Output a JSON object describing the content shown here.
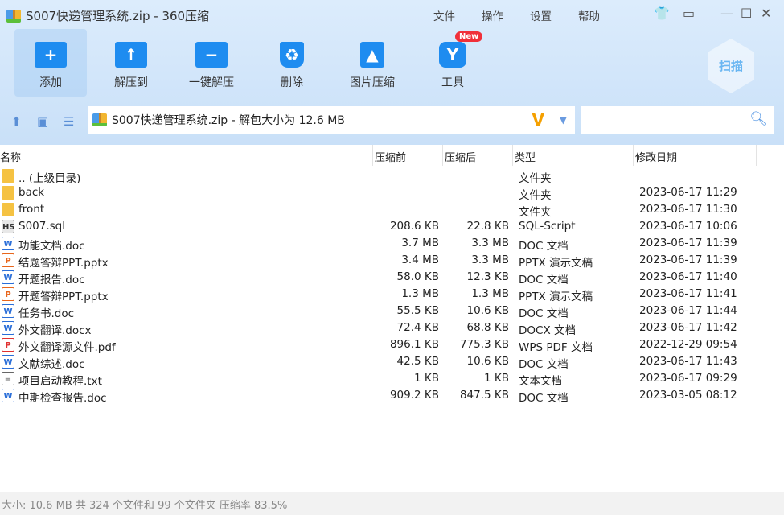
{
  "window": {
    "title": "S007快递管理系统.zip - 360压缩",
    "menu": [
      "文件",
      "操作",
      "设置",
      "帮助"
    ]
  },
  "toolbar": [
    {
      "label": "添加",
      "icon": "add-folder-icon"
    },
    {
      "label": "解压到",
      "icon": "extract-to-icon"
    },
    {
      "label": "一键解压",
      "icon": "one-click-extract-icon"
    },
    {
      "label": "删除",
      "icon": "delete-icon"
    },
    {
      "label": "图片压缩",
      "icon": "image-compress-icon"
    },
    {
      "label": "工具",
      "icon": "tools-icon"
    }
  ],
  "new_badge": "New",
  "scan_label": "扫描",
  "address": "S007快递管理系统.zip - 解包大小为 12.6 MB",
  "search": {
    "placeholder": ""
  },
  "columns": [
    "名称",
    "压缩前",
    "压缩后",
    "类型",
    "修改日期"
  ],
  "files": [
    {
      "name": ".. (上级目录)",
      "size": "",
      "packed": "",
      "type": "文件夹",
      "date": "",
      "icon": "folder"
    },
    {
      "name": "back",
      "size": "",
      "packed": "",
      "type": "文件夹",
      "date": "2023-06-17 11:29",
      "icon": "folder"
    },
    {
      "name": "front",
      "size": "",
      "packed": "",
      "type": "文件夹",
      "date": "2023-06-17 11:30",
      "icon": "folder"
    },
    {
      "name": "S007.sql",
      "size": "208.6 KB",
      "packed": "22.8 KB",
      "type": "SQL-Script",
      "date": "2023-06-17 10:06",
      "icon": "sql"
    },
    {
      "name": "功能文档.doc",
      "size": "3.7 MB",
      "packed": "3.3 MB",
      "type": "DOC 文档",
      "date": "2023-06-17 11:39",
      "icon": "doc"
    },
    {
      "name": "结题答辩PPT.pptx",
      "size": "3.4 MB",
      "packed": "3.3 MB",
      "type": "PPTX 演示文稿",
      "date": "2023-06-17 11:39",
      "icon": "ppt"
    },
    {
      "name": "开题报告.doc",
      "size": "58.0 KB",
      "packed": "12.3 KB",
      "type": "DOC 文档",
      "date": "2023-06-17 11:40",
      "icon": "doc"
    },
    {
      "name": "开题答辩PPT.pptx",
      "size": "1.3 MB",
      "packed": "1.3 MB",
      "type": "PPTX 演示文稿",
      "date": "2023-06-17 11:41",
      "icon": "ppt"
    },
    {
      "name": "任务书.doc",
      "size": "55.5 KB",
      "packed": "10.6 KB",
      "type": "DOC 文档",
      "date": "2023-06-17 11:44",
      "icon": "doc"
    },
    {
      "name": "外文翻译.docx",
      "size": "72.4 KB",
      "packed": "68.8 KB",
      "type": "DOCX 文档",
      "date": "2023-06-17 11:42",
      "icon": "doc"
    },
    {
      "name": "外文翻译源文件.pdf",
      "size": "896.1 KB",
      "packed": "775.3 KB",
      "type": "WPS PDF 文档",
      "date": "2022-12-29 09:54",
      "icon": "pdf"
    },
    {
      "name": "文献综述.doc",
      "size": "42.5 KB",
      "packed": "10.6 KB",
      "type": "DOC 文档",
      "date": "2023-06-17 11:43",
      "icon": "doc"
    },
    {
      "name": "项目启动教程.txt",
      "size": "1 KB",
      "packed": "1 KB",
      "type": "文本文档",
      "date": "2023-06-17 09:29",
      "icon": "txt"
    },
    {
      "name": "中期检查报告.doc",
      "size": "909.2 KB",
      "packed": "847.5 KB",
      "type": "DOC 文档",
      "date": "2023-03-05 08:12",
      "icon": "doc"
    }
  ],
  "status": "大小: 10.6 MB 共 324 个文件和 99 个文件夹 压缩率 83.5%"
}
